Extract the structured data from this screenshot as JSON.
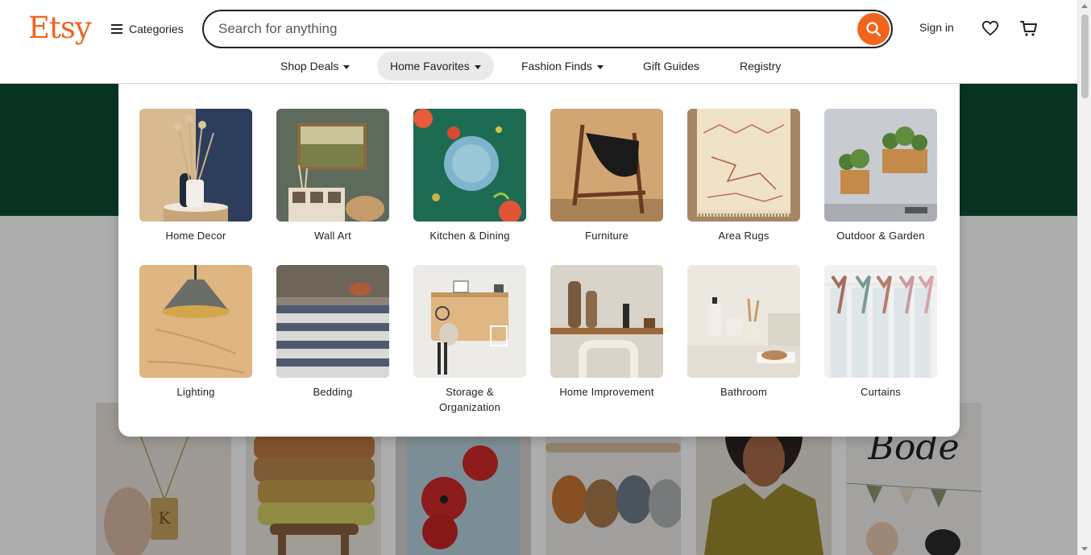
{
  "brand": {
    "logo": "Etsy",
    "accent": "#f1641e"
  },
  "header": {
    "categories_label": "Categories",
    "search_placeholder": "Search for anything",
    "sign_in": "Sign in",
    "icons": [
      "menu-icon",
      "search-icon",
      "heart-icon",
      "cart-icon"
    ]
  },
  "nav": {
    "items": [
      {
        "label": "Shop Deals",
        "has_caret": true
      },
      {
        "label": "Home Favorites",
        "has_caret": true,
        "active": true
      },
      {
        "label": "Fashion Finds",
        "has_caret": true
      },
      {
        "label": "Gift Guides",
        "has_caret": false
      },
      {
        "label": "Registry",
        "has_caret": false
      }
    ]
  },
  "menu": {
    "tiles": [
      {
        "label": "Home Decor"
      },
      {
        "label": "Wall Art"
      },
      {
        "label": "Kitchen & Dining"
      },
      {
        "label": "Furniture"
      },
      {
        "label": "Area Rugs"
      },
      {
        "label": "Outdoor & Garden"
      },
      {
        "label": "Lighting"
      },
      {
        "label": "Bedding"
      },
      {
        "label": "Storage & Organization"
      },
      {
        "label": "Home Improvement"
      },
      {
        "label": "Bathroom"
      },
      {
        "label": "Curtains"
      }
    ]
  },
  "colors": {
    "hero_green": "#0e4d33",
    "text": "#222222"
  }
}
